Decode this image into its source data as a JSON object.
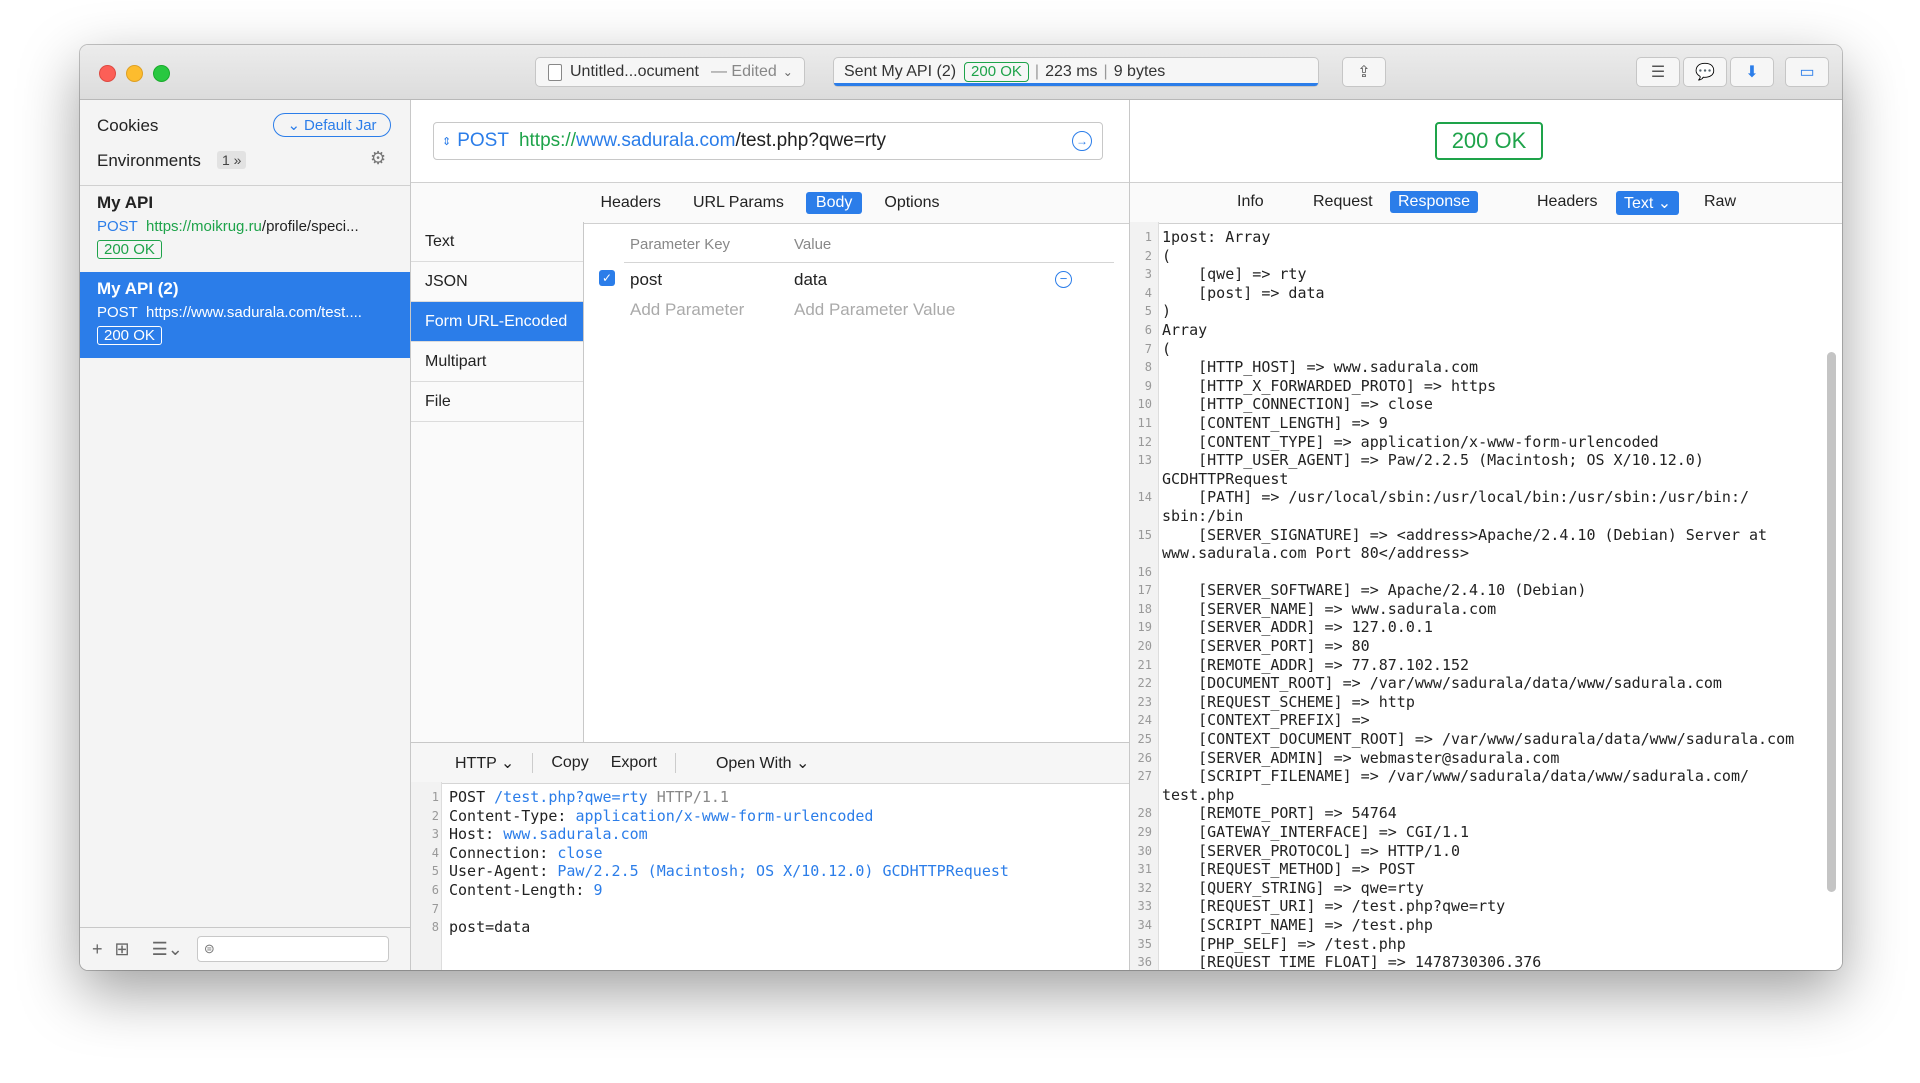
{
  "titlebar": {
    "document": "Untitled...ocument",
    "edited": "— Edited",
    "status_request": "Sent My API (2)",
    "status_code": "200 OK",
    "status_time": "223 ms",
    "status_size": "9 bytes"
  },
  "sidebar": {
    "cookies_label": "Cookies",
    "jar_label": "Default Jar",
    "environments_label": "Environments",
    "environments_count": "1",
    "requests": [
      {
        "name": "My API",
        "method": "POST",
        "scheme": "https://",
        "host": "moikrug.ru",
        "path": "/profile/speci...",
        "status": "200 OK"
      },
      {
        "name": "My API (2)",
        "method": "POST",
        "scheme": "https://",
        "host": "www.sadurala.com",
        "path": "/test....",
        "status": "200 OK"
      }
    ]
  },
  "request": {
    "method": "POST",
    "url_scheme": "https://",
    "url_host": "www.sadurala.com",
    "url_path": "/test.php?qwe=rty",
    "tabs": [
      "Headers",
      "URL Params",
      "Body",
      "Options"
    ],
    "active_tab": "Body",
    "body_types": [
      "Text",
      "JSON",
      "Form URL-Encoded",
      "Multipart",
      "File"
    ],
    "active_body_type": "Form URL-Encoded",
    "param_header_key": "Parameter Key",
    "param_header_value": "Value",
    "params": [
      {
        "key": "post",
        "value": "data",
        "enabled": true
      }
    ],
    "add_key_placeholder": "Add Parameter",
    "add_value_placeholder": "Add Parameter Value",
    "raw_toolbar": {
      "format": "HTTP",
      "copy": "Copy",
      "export": "Export",
      "open_with": "Open With"
    },
    "raw_lines": [
      {
        "n": "1",
        "a": "POST ",
        "b": "/test.php?qwe=rty",
        "c": " HTTP/1.1"
      },
      {
        "n": "2",
        "a": "Content-Type: ",
        "b": "application/x-www-form-urlencoded",
        "c": ""
      },
      {
        "n": "3",
        "a": "Host: ",
        "b": "www.sadurala.com",
        "c": ""
      },
      {
        "n": "4",
        "a": "Connection: ",
        "b": "close",
        "c": ""
      },
      {
        "n": "5",
        "a": "User-Agent: ",
        "b": "Paw/2.2.5 (Macintosh; OS X/10.12.0) GCDHTTPRequest",
        "c": ""
      },
      {
        "n": "6",
        "a": "Content-Length: ",
        "b": "9",
        "c": ""
      },
      {
        "n": "7",
        "a": "",
        "b": "",
        "c": ""
      },
      {
        "n": "8",
        "a": "post=data",
        "b": "",
        "c": ""
      }
    ]
  },
  "response": {
    "status": "200 OK",
    "tabs": [
      "Info",
      "Request",
      "Response",
      "Headers",
      "Text",
      "Raw"
    ],
    "active_tab": "Response",
    "format": "Text",
    "gutter": [
      "1",
      "2",
      "3",
      "4",
      "5",
      "6",
      "7",
      "8",
      "9",
      "10",
      "11",
      "12",
      "13",
      "",
      "14",
      "",
      "15",
      "",
      "16",
      "17",
      "18",
      "19",
      "20",
      "21",
      "22",
      "23",
      "24",
      "25",
      "26",
      "27",
      "",
      "28",
      "29",
      "30",
      "31",
      "32",
      "33",
      "34",
      "35",
      "36"
    ],
    "lines": [
      "1post: Array",
      "(",
      "    [qwe] => rty",
      "    [post] => data",
      ")",
      "Array",
      "(",
      "    [HTTP_HOST] => www.sadurala.com",
      "    [HTTP_X_FORWARDED_PROTO] => https",
      "    [HTTP_CONNECTION] => close",
      "    [CONTENT_LENGTH] => 9",
      "    [CONTENT_TYPE] => application/x-www-form-urlencoded",
      "    [HTTP_USER_AGENT] => Paw/2.2.5 (Macintosh; OS X/10.12.0)",
      "GCDHTTPRequest",
      "    [PATH] => /usr/local/sbin:/usr/local/bin:/usr/sbin:/usr/bin:/",
      "sbin:/bin",
      "    [SERVER_SIGNATURE] => <address>Apache/2.4.10 (Debian) Server at",
      "www.sadurala.com Port 80</address>",
      "",
      "    [SERVER_SOFTWARE] => Apache/2.4.10 (Debian)",
      "    [SERVER_NAME] => www.sadurala.com",
      "    [SERVER_ADDR] => 127.0.0.1",
      "    [SERVER_PORT] => 80",
      "    [REMOTE_ADDR] => 77.87.102.152",
      "    [DOCUMENT_ROOT] => /var/www/sadurala/data/www/sadurala.com",
      "    [REQUEST_SCHEME] => http",
      "    [CONTEXT_PREFIX] =>",
      "    [CONTEXT_DOCUMENT_ROOT] => /var/www/sadurala/data/www/sadurala.com",
      "    [SERVER_ADMIN] => webmaster@sadurala.com",
      "    [SCRIPT_FILENAME] => /var/www/sadurala/data/www/sadurala.com/",
      "test.php",
      "    [REMOTE_PORT] => 54764",
      "    [GATEWAY_INTERFACE] => CGI/1.1",
      "    [SERVER_PROTOCOL] => HTTP/1.0",
      "    [REQUEST_METHOD] => POST",
      "    [QUERY_STRING] => qwe=rty",
      "    [REQUEST_URI] => /test.php?qwe=rty",
      "    [SCRIPT_NAME] => /test.php",
      "    [PHP_SELF] => /test.php",
      "    [REQUEST_TIME_FLOAT] => 1478730306.376"
    ]
  },
  "colors": {
    "accent": "#2b7de9",
    "success": "#1ea34a"
  }
}
